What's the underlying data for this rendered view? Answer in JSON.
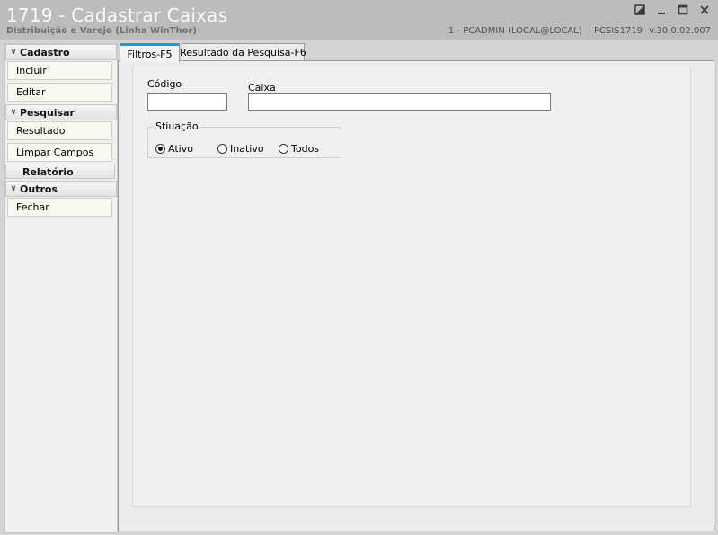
{
  "window": {
    "title": "1719 - Cadastrar Caixas",
    "subtitle": "Distribuição e Varejo (Linha WinThor)",
    "user_info": "1 - PCADMIN (LOCAL@LOCAL)",
    "program": "PCSIS1719",
    "version": "v.30.0.02.007",
    "controls": [
      "restore-icon",
      "minimize-icon",
      "maximize-icon",
      "close-icon"
    ]
  },
  "sidebar": {
    "groups": [
      {
        "label": "Cadastro",
        "items": [
          "Incluir",
          "Editar"
        ]
      },
      {
        "label": "Pesquisar",
        "items": [
          "Resultado",
          "Limpar Campos"
        ]
      },
      {
        "label": "Relatório",
        "items": []
      },
      {
        "label": "Outros",
        "items": [
          "Fechar"
        ]
      }
    ]
  },
  "tabs": [
    {
      "label": "Filtros-F5",
      "active": true
    },
    {
      "label": "Resultado da Pesquisa-F6",
      "active": false
    }
  ],
  "filters": {
    "codigo_label": "Código",
    "codigo_value": "",
    "caixa_label": "Caixa",
    "caixa_value": "",
    "situacao": {
      "label": "Stiuação",
      "options": [
        "Ativo",
        "Inativo",
        "Todos"
      ],
      "selected": "Ativo"
    }
  },
  "colors": {
    "title_bar": "#bcbcbc",
    "active_tab_accent": "#2f8fd0",
    "sidebar_button": "#f9f8ef"
  }
}
